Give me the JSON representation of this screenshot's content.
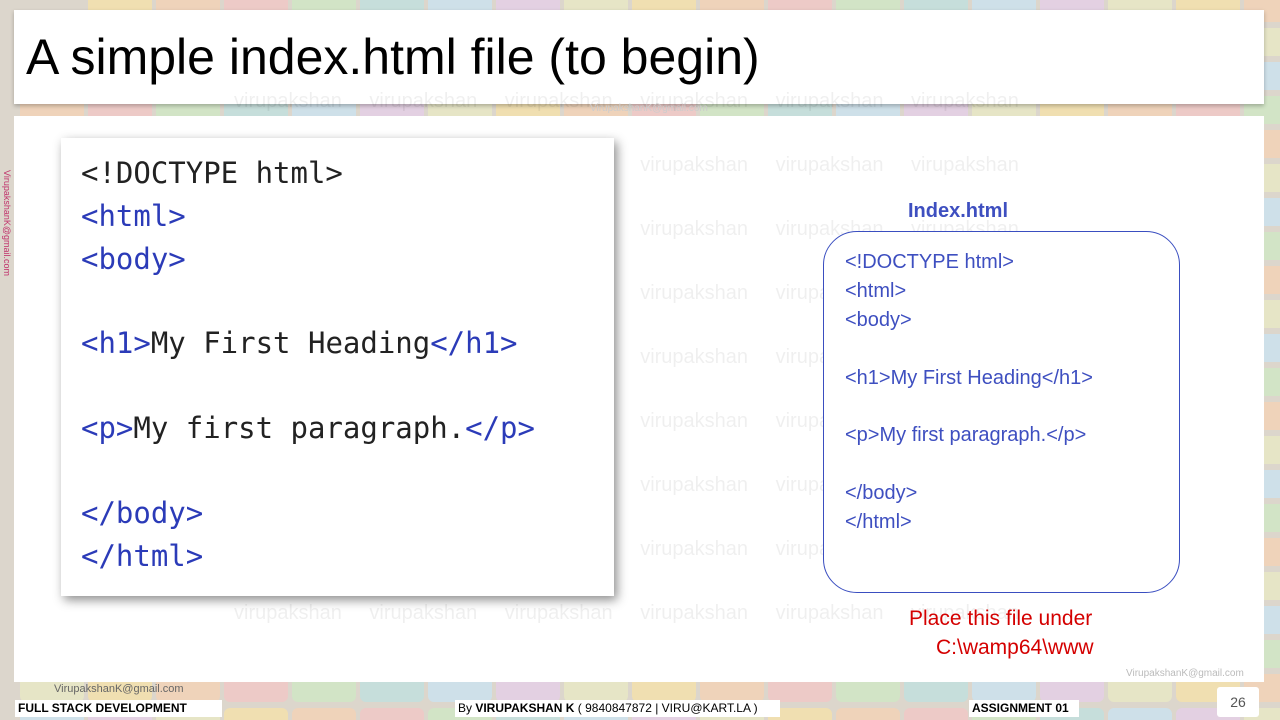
{
  "slide": {
    "title": "A simple index.html  file  (to begin)",
    "watermark": "virupakshan virupakshan virupakshan virupakshan virupakshan virupakshan",
    "email": "VirupakshanK@gmail.com"
  },
  "code_image": {
    "lines": [
      {
        "tag1": "<!DOCTYPE html>",
        "text": "",
        "tag2": ""
      },
      {
        "tag1": "<html>",
        "text": "",
        "tag2": ""
      },
      {
        "tag1": "<body>",
        "text": "",
        "tag2": ""
      },
      {
        "tag1": "<h1>",
        "text": "My First Heading",
        "tag2": "</h1>"
      },
      {
        "tag1": "<p>",
        "text": "My first paragraph.",
        "tag2": "</p>"
      },
      {
        "tag1": "</body>",
        "text": "",
        "tag2": ""
      },
      {
        "tag1": "</html>",
        "text": "",
        "tag2": ""
      }
    ]
  },
  "code_box": {
    "title": "Index.html",
    "lines": [
      "<!DOCTYPE html>",
      "<html>",
      "<body>",
      "<h1>My First Heading</h1>",
      "<p>My first paragraph.</p>",
      "</body>",
      "</html>"
    ]
  },
  "note": {
    "line1": "Place this file under",
    "line2": "C:\\wamp64\\www"
  },
  "footer": {
    "left": "FULL STACK DEVELOPMENT",
    "center_prefix": "By ",
    "center_name": "VIRUPAKSHAN K",
    "center_rest": " ( 9840847872 | VIRU@KART.LA )",
    "right": "ASSIGNMENT 01",
    "page_number": "26"
  },
  "colors": {
    "tag": "#2b3bb8",
    "box_text": "#3e4fc0",
    "note": "#d40000"
  }
}
